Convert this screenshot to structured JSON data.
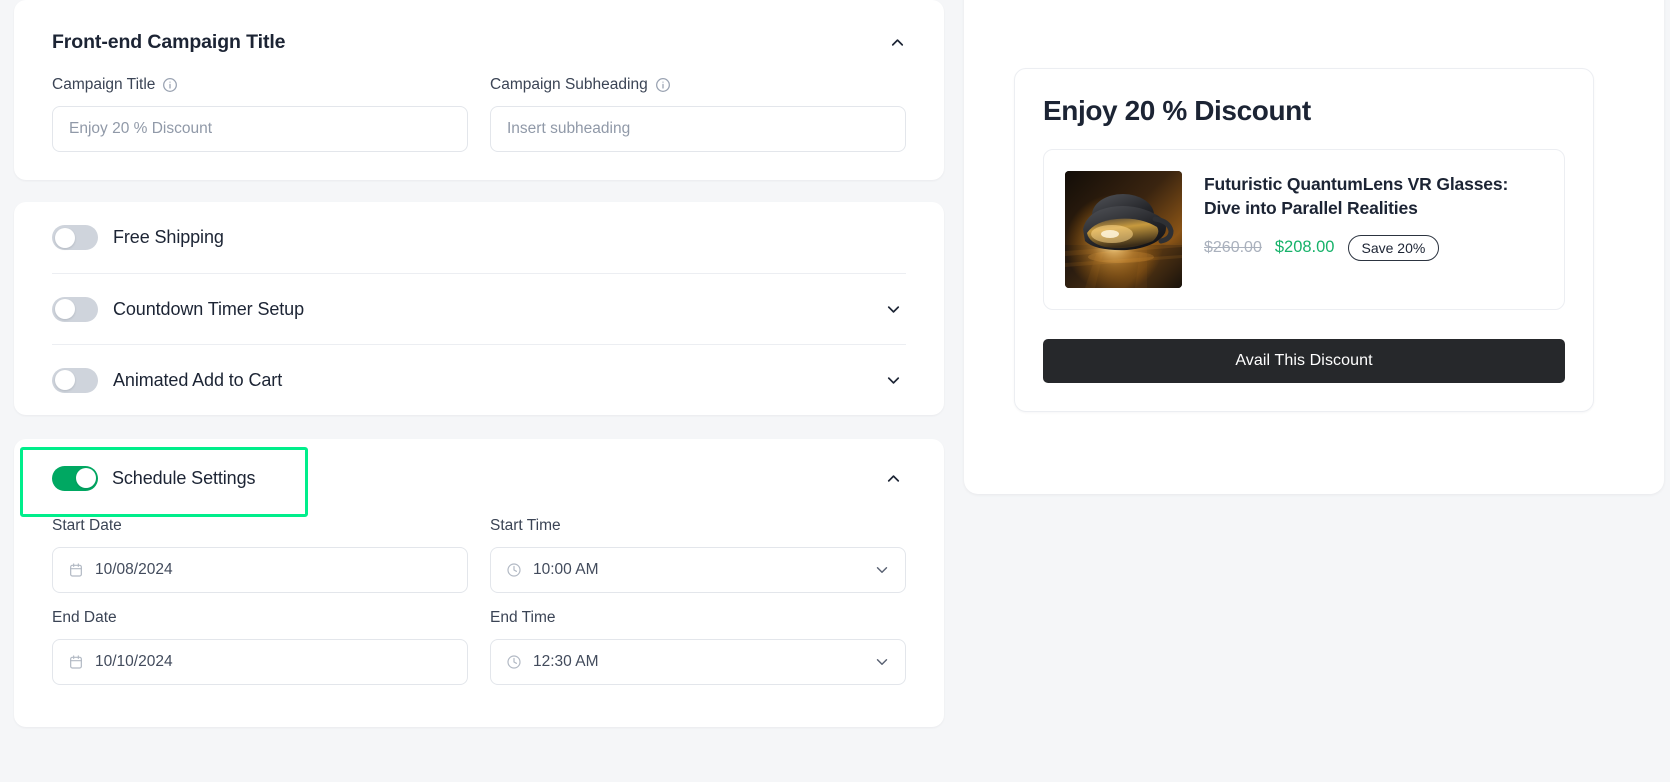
{
  "editor": {
    "title_section": {
      "heading": "Front-end Campaign Title",
      "collapse_icon": "chevron-up-icon",
      "fields": [
        {
          "label": "Campaign Title",
          "info_icon": "info-circle-icon",
          "value": "Enjoy 20 % Discount",
          "placeholder": "Enjoy 20 % Discount"
        },
        {
          "label": "Campaign Subheading",
          "info_icon": "info-circle-icon",
          "value": "",
          "placeholder": "Insert subheading"
        }
      ]
    },
    "toggle_section": {
      "rows": [
        {
          "label": "Free Shipping",
          "enabled": false,
          "has_chevron": false
        },
        {
          "label": "Countdown Timer Setup",
          "enabled": false,
          "has_chevron": true,
          "chevron_icon": "chevron-down-icon"
        },
        {
          "label": "Animated Add to Cart",
          "enabled": false,
          "has_chevron": true,
          "chevron_icon": "chevron-down-icon"
        }
      ]
    },
    "schedule_section": {
      "label": "Schedule Settings",
      "enabled": true,
      "collapse_icon": "chevron-up-icon",
      "highlighted": true,
      "highlight_color": "#00ee8b",
      "toggle_on_color": "#00a862",
      "fields": [
        {
          "label": "Start Date",
          "value": "10/08/2024",
          "icon": "calendar-icon",
          "dropdown": false
        },
        {
          "label": "Start Time",
          "value": "10:00 AM",
          "icon": "clock-icon",
          "dropdown": true,
          "dropdown_icon": "chevron-down-icon"
        },
        {
          "label": "End Date",
          "value": "10/10/2024",
          "icon": "calendar-icon",
          "dropdown": false
        },
        {
          "label": "End Time",
          "value": "12:30 AM",
          "icon": "clock-icon",
          "dropdown": true,
          "dropdown_icon": "chevron-down-icon"
        }
      ]
    }
  },
  "preview": {
    "promo_title": "Enjoy 20 % Discount",
    "product": {
      "name": "Futuristic QuantumLens VR Glasses: Dive into Parallel Realities",
      "image_alt": "futuristic-vr-glasses-thumbnail",
      "original_price": "$260.00",
      "discounted_price": "$208.00",
      "save_badge": "Save 20%",
      "discount_color": "#17b26a"
    },
    "cta_label": "Avail This Discount",
    "cta_color": "#26282b"
  }
}
